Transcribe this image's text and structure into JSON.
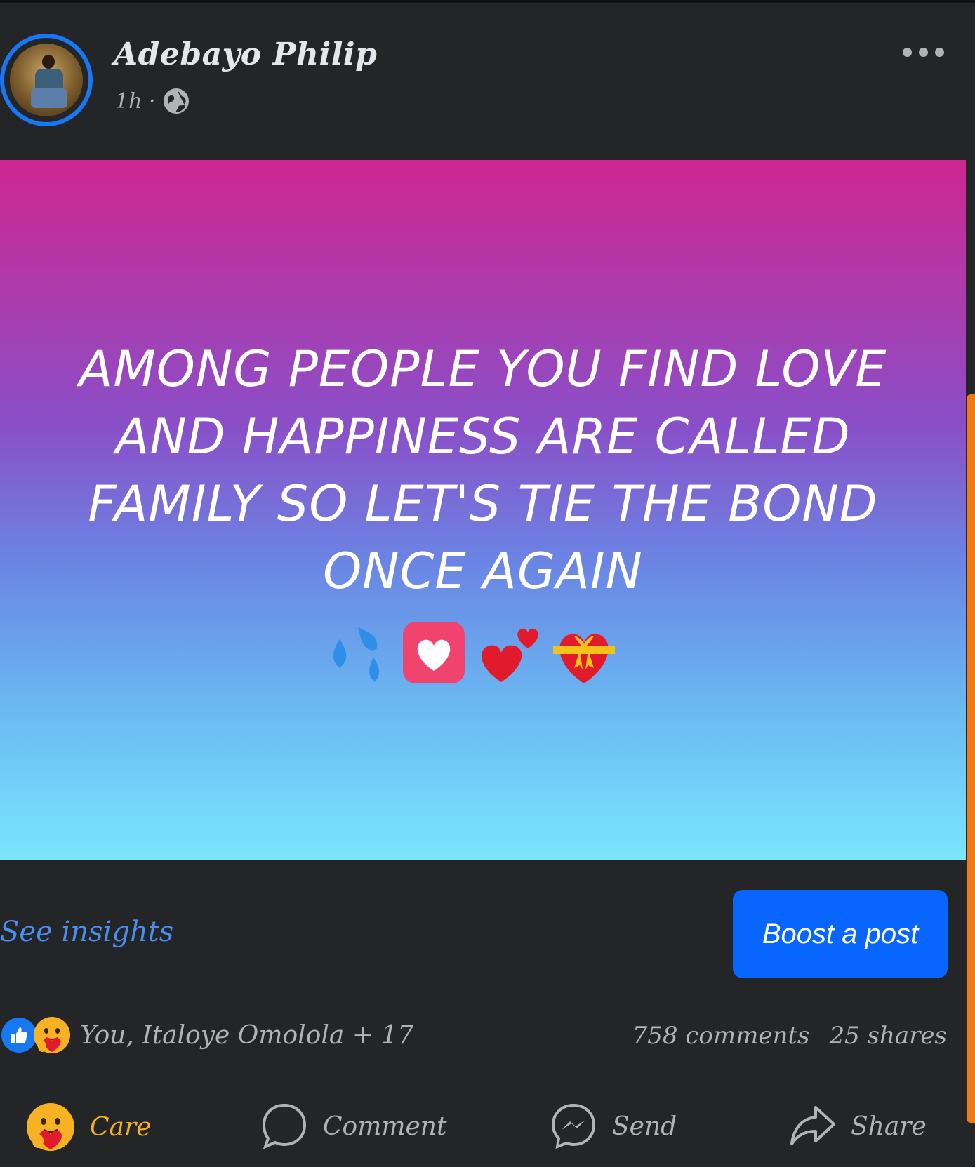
{
  "post": {
    "author": "Adebayo Philip",
    "time": "1h ·",
    "privacy_icon": "globe-icon",
    "text": "AMONG PEOPLE YOU FIND LOVE AND HAPPINESS ARE CALLED FAMILY SO LET'S TIE THE BOND ONCE AGAIN",
    "emojis": [
      "droplets-icon",
      "heart-square-icon",
      "two-hearts-icon",
      "gift-heart-icon"
    ],
    "background_gradient": [
      "#cf2690",
      "#8a4fc8",
      "#6a86e4",
      "#6ab8f2",
      "#7ae6fd"
    ]
  },
  "insights": {
    "label": "See insights"
  },
  "boost": {
    "label": "Boost a post",
    "color": "#0866ff"
  },
  "reactions": {
    "icons": [
      "like-icon",
      "care-icon"
    ],
    "text": "You, Italoye Omolola + 17"
  },
  "counts": {
    "comments": "758 comments",
    "shares": "25 shares"
  },
  "actions": {
    "care": "Care",
    "comment": "Comment",
    "send": "Send",
    "share": "Share"
  },
  "colors": {
    "background": "#242526",
    "accent": "#1877f2",
    "care": "#f7b125",
    "text_secondary": "#b0b3b8"
  }
}
